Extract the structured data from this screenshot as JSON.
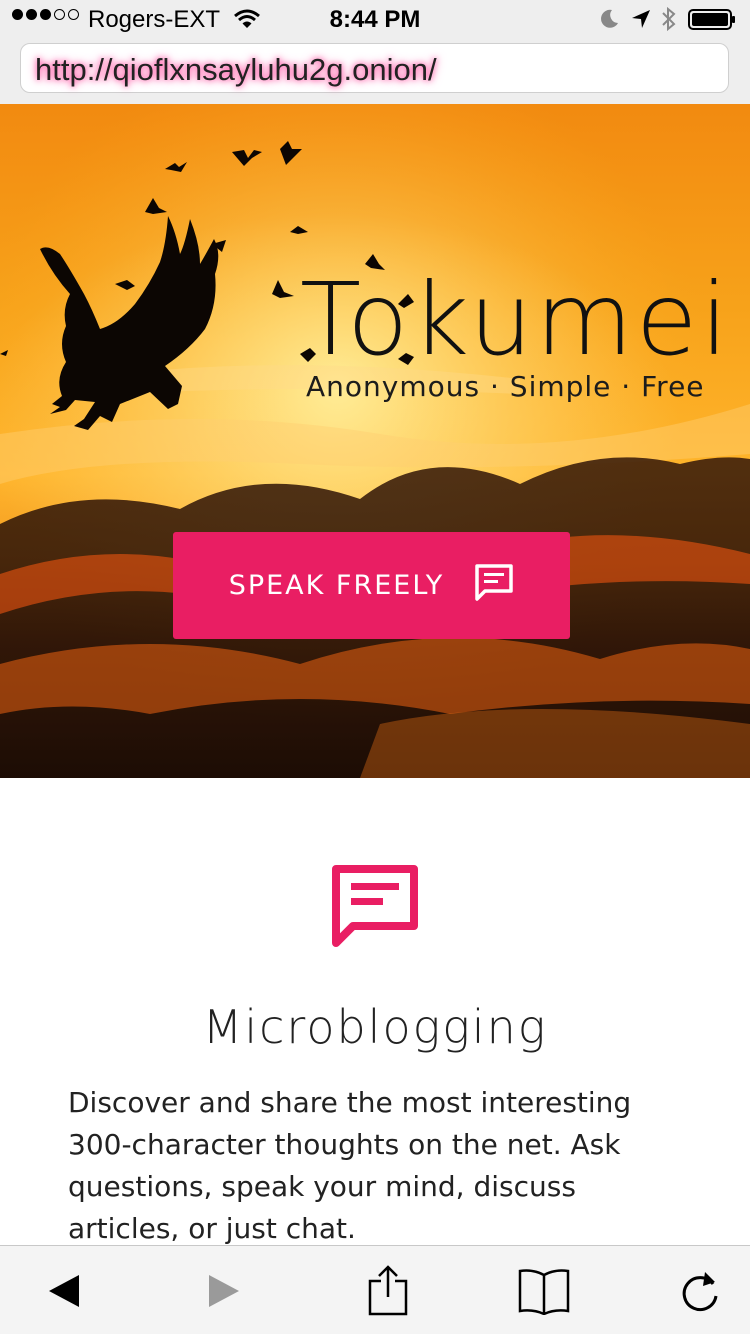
{
  "status_bar": {
    "carrier": "Rogers-EXT",
    "time": "8:44 PM",
    "signal_bars_filled": 3,
    "signal_bars_total": 5
  },
  "browser": {
    "url": "http://qioflxnsayluhu2g.onion/"
  },
  "hero": {
    "brand": "Tokumei",
    "tagline": "Anonymous · Simple · Free",
    "cta_label": "SPEAK FREELY",
    "icon": "comment-icon"
  },
  "feature": {
    "icon": "comment-icon",
    "title": "Microblogging",
    "description": "Discover and share the most interesting 300-character thoughts on the net. Ask questions, speak your mind, discuss articles, or just chat."
  },
  "toolbar": {
    "items": [
      "back-icon",
      "forward-icon",
      "share-icon",
      "bookmarks-icon",
      "reload-icon"
    ]
  },
  "colors": {
    "accent": "#e91e63",
    "hero_orange": "#f7a21a",
    "url_highlight": "#ff4fa3"
  }
}
